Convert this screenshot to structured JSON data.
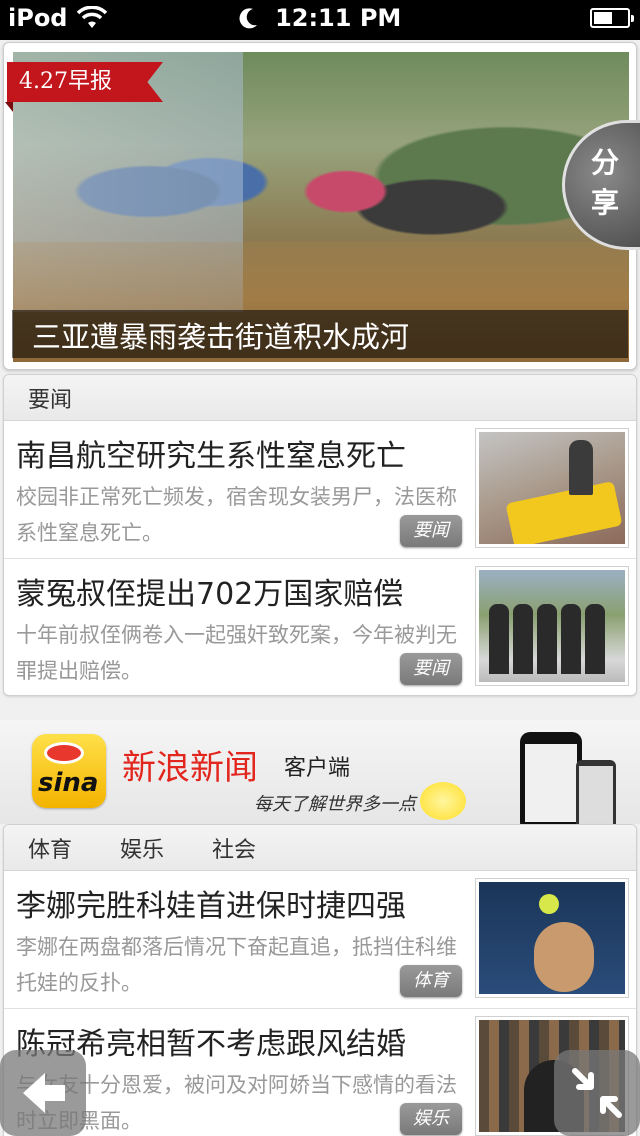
{
  "status_bar": {
    "device": "iPod",
    "time": "12:11 PM",
    "wifi_icon": "wifi-icon",
    "moon_icon": "moon-icon",
    "battery_level": 0.55
  },
  "hero": {
    "date_badge": "4.27早报",
    "caption": "三亚遭暴雨袭击街道积水成河",
    "share_label": "分享"
  },
  "section_top": {
    "tab": "要闻",
    "items": [
      {
        "title": "南昌航空研究生系性窒息死亡",
        "summary": "校园非正常死亡频发，宿舍现女装男尸，法医称系性窒息死亡。",
        "tag": "要闻"
      },
      {
        "title": "蒙冤叔侄提出702万国家赔偿",
        "summary": "十年前叔侄俩卷入一起强奸致死案，今年被判无罪提出赔偿。",
        "tag": "要闻"
      }
    ]
  },
  "ad": {
    "logo_text": "sina",
    "title": "新浪新闻",
    "subtitle": "客户端",
    "slogan": "每天了解世界多一点"
  },
  "section_bottom": {
    "tabs": [
      "体育",
      "娱乐",
      "社会"
    ],
    "items": [
      {
        "title": "李娜完胜科娃首进保时捷四强",
        "summary": "李娜在两盘都落后情况下奋起直追，抵挡住科维托娃的反扑。",
        "tag": "体育"
      },
      {
        "title": "陈冠希亮相暂不考虑跟风结婚",
        "summary": "与女友十分恩爱，被问及对阿娇当下感情的看法时立即黑面。",
        "tag": "娱乐"
      }
    ]
  },
  "controls": {
    "back_icon": "arrow-left-icon",
    "collapse_icon": "collapse-arrows-icon"
  },
  "colors": {
    "accent_red": "#c3161c",
    "sina_red": "#e2261d",
    "tag_gray": "#8a8a8a"
  }
}
